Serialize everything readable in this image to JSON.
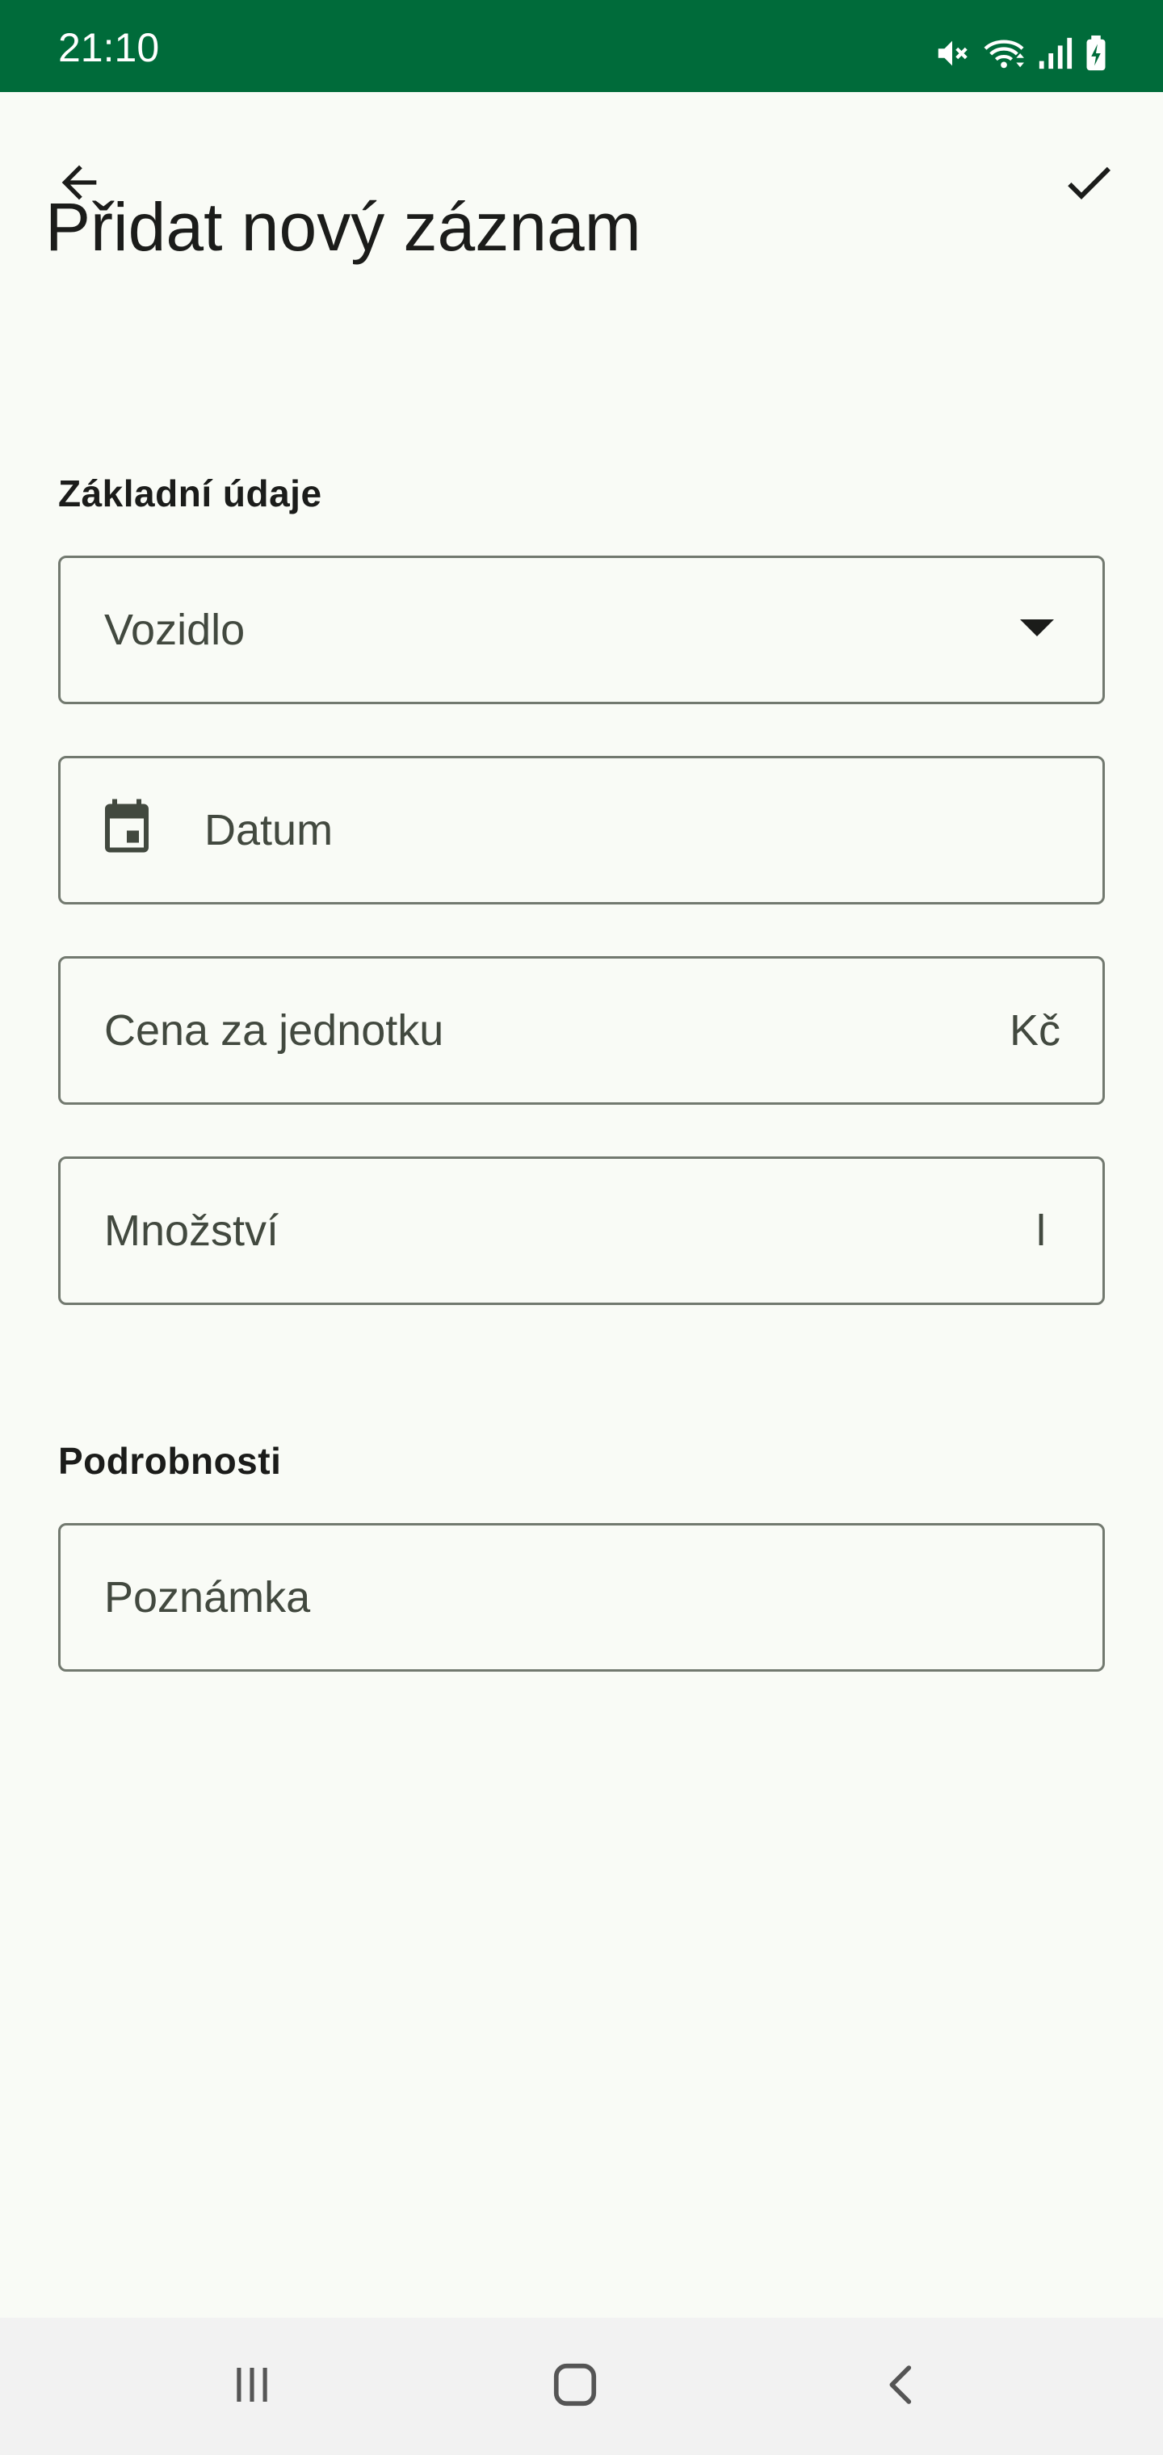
{
  "status_bar": {
    "time": "21:10",
    "icons": [
      "mute-icon",
      "wifi-icon",
      "signal-icon",
      "battery-charging-icon"
    ]
  },
  "app_bar": {
    "back_icon": "arrow-back-icon",
    "save_icon": "check-icon",
    "title": "Přidat nový záznam"
  },
  "sections": {
    "basic": {
      "label": "Základní údaje",
      "vehicle": {
        "placeholder": "Vozidlo",
        "icon": "dropdown-arrow-icon"
      },
      "date": {
        "placeholder": "Datum",
        "icon": "calendar-icon"
      },
      "unit_price": {
        "placeholder": "Cena za jednotku",
        "suffix": "Kč"
      },
      "quantity": {
        "placeholder": "Množství",
        "suffix": "l"
      }
    },
    "details": {
      "label": "Podrobnosti",
      "note": {
        "placeholder": "Poznámka"
      }
    }
  },
  "nav_bar": {
    "icons": [
      "recent-apps-icon",
      "home-icon",
      "back-nav-icon"
    ]
  },
  "colors": {
    "status_bar": "#006b3a",
    "background": "#f9fbf6",
    "outline": "#72796f",
    "text": "#1b1c1a"
  }
}
